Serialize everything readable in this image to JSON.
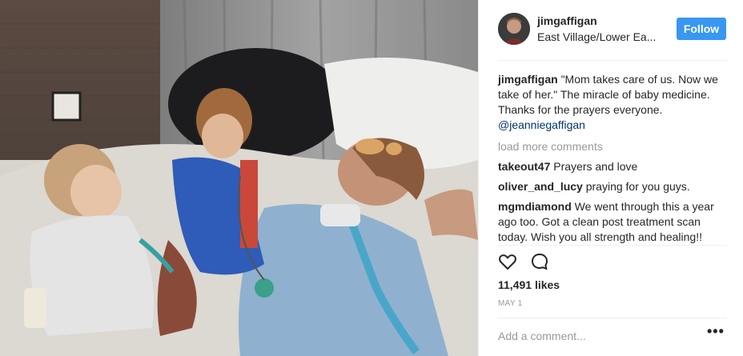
{
  "header": {
    "username": "jimgaffigan",
    "location": "East Village/Lower Ea...",
    "follow_label": "Follow"
  },
  "caption": {
    "username": "jimgaffigan",
    "text": "\"Mom takes care of us. Now we take of her.\" The miracle of baby medicine. Thanks for the prayers everyone.",
    "mention": "@jeanniegaffigan"
  },
  "load_more_label": "load more comments",
  "comments": [
    {
      "username": "takeout47",
      "text": "Prayers and love"
    },
    {
      "username": "oliver_and_lucy",
      "text": "praying for you guys."
    },
    {
      "username": "mgmdiamond",
      "text": "We went through this a year ago too. Got a clean post treatment scan today. Wish you all strength and healing!!"
    }
  ],
  "icons": {
    "like": "heart-icon",
    "comment": "comment-bubble-icon",
    "more": "more-options-icon"
  },
  "likes_label": "11,491 likes",
  "date_label": "MAY 1",
  "add_comment_placeholder": "Add a comment...",
  "more_label": "•••",
  "colors": {
    "follow_button": "#3897f0",
    "mention": "#003569",
    "muted": "#999999"
  }
}
